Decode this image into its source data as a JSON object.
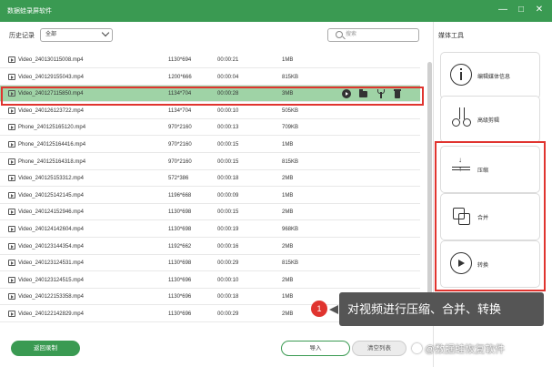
{
  "app": {
    "title": "数据蛙录屏软件"
  },
  "window_controls": {
    "minimize": "—",
    "restore": "□",
    "close": "✕"
  },
  "toolbar": {
    "history_label": "历史记录",
    "filter_value": "全部",
    "search_placeholder": "搜索"
  },
  "files": [
    {
      "name": "Video_240130115008.mp4",
      "res": "1130*694",
      "dur": "00:00:21",
      "size": "1MB"
    },
    {
      "name": "Video_240129155043.mp4",
      "res": "1200*666",
      "dur": "00:00:04",
      "size": "815KB"
    },
    {
      "name": "Video_240127115850.mp4",
      "res": "1134*704",
      "dur": "00:00:28",
      "size": "3MB",
      "selected": true
    },
    {
      "name": "Video_240126123722.mp4",
      "res": "1134*704",
      "dur": "00:00:10",
      "size": "505KB"
    },
    {
      "name": "Phone_240125165120.mp4",
      "res": "970*2160",
      "dur": "00:00:13",
      "size": "709KB"
    },
    {
      "name": "Phone_240125164416.mp4",
      "res": "970*2160",
      "dur": "00:00:15",
      "size": "1MB"
    },
    {
      "name": "Phone_240125164318.mp4",
      "res": "970*2160",
      "dur": "00:00:15",
      "size": "815KB"
    },
    {
      "name": "Video_240125153312.mp4",
      "res": "572*386",
      "dur": "00:00:18",
      "size": "2MB"
    },
    {
      "name": "Video_240125142145.mp4",
      "res": "1196*668",
      "dur": "00:00:09",
      "size": "1MB"
    },
    {
      "name": "Video_240124152946.mp4",
      "res": "1130*698",
      "dur": "00:00:15",
      "size": "2MB"
    },
    {
      "name": "Video_240124142604.mp4",
      "res": "1130*698",
      "dur": "00:00:19",
      "size": "968KB"
    },
    {
      "name": "Video_240123144354.mp4",
      "res": "1192*662",
      "dur": "00:00:16",
      "size": "2MB"
    },
    {
      "name": "Video_240123124531.mp4",
      "res": "1130*698",
      "dur": "00:00:29",
      "size": "815KB"
    },
    {
      "name": "Video_240123124515.mp4",
      "res": "1130*696",
      "dur": "00:00:10",
      "size": "2MB"
    },
    {
      "name": "Video_240122153358.mp4",
      "res": "1130*696",
      "dur": "00:00:18",
      "size": "1MB"
    },
    {
      "name": "Video_240122142829.mp4",
      "res": "1130*696",
      "dur": "00:00:29",
      "size": "2MB"
    }
  ],
  "side_panel": {
    "title": "媒体工具",
    "tools": [
      {
        "label": "编辑媒体信息",
        "icon": "info-icon"
      },
      {
        "label": "高级剪辑",
        "icon": "scissors-icon"
      },
      {
        "label": "压缩",
        "icon": "compress-icon"
      },
      {
        "label": "合并",
        "icon": "merge-icon"
      },
      {
        "label": "转换",
        "icon": "convert-icon"
      }
    ]
  },
  "footer": {
    "back_label": "返回录制",
    "import_label": "导入",
    "clear_label": "清空列表"
  },
  "callout": {
    "number": "1",
    "text": "对视频进行压缩、合并、转换"
  },
  "watermark": "@数据蛙恢复软件",
  "colors": {
    "brand_green": "#3a9a52",
    "selected_row": "#9fd3a6",
    "highlight_red": "#e0342f"
  }
}
